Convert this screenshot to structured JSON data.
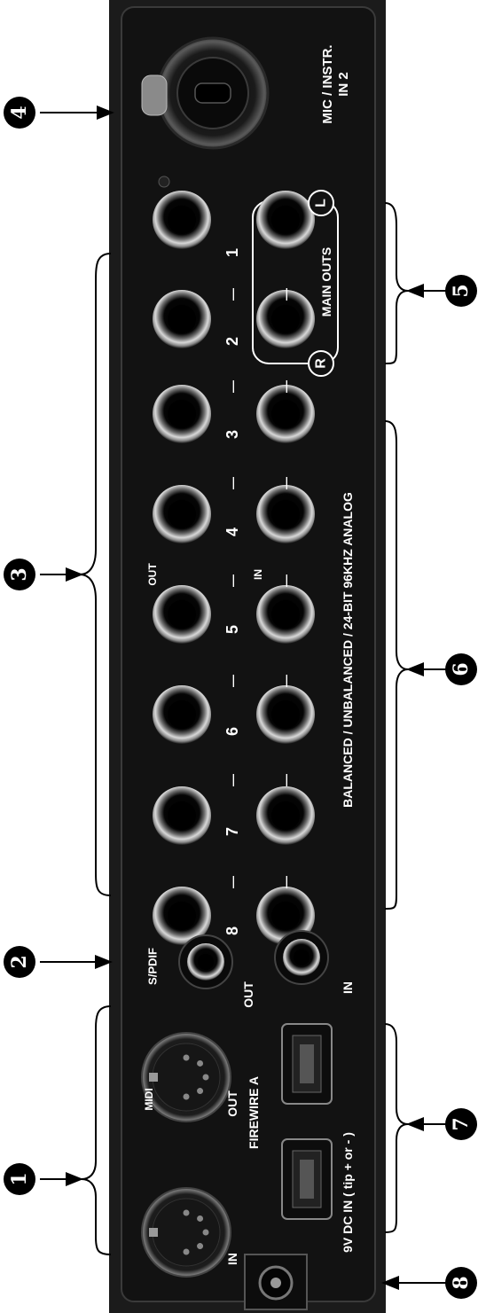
{
  "callouts": [
    "1",
    "2",
    "3",
    "4",
    "5",
    "6",
    "7",
    "8"
  ],
  "panel": {
    "mic_instr_line1": "MIC / INSTR.",
    "mic_instr_line2": "IN 2",
    "main_outs": "MAIN OUTS",
    "main_outs_l": "L",
    "main_outs_r": "R",
    "analog_label": "BALANCED / UNBALANCED / 24-BIT 96KHZ ANALOG",
    "out_label": "OUT",
    "in_label": "IN",
    "channel_numbers": [
      "1",
      "2",
      "3",
      "4",
      "5",
      "6",
      "7",
      "8"
    ],
    "dash": "—",
    "spdif": "S/PDIF",
    "spdif_out": "OUT",
    "spdif_in": "IN",
    "midi": "MIDI",
    "midi_out": "OUT",
    "midi_in": "IN",
    "firewire": "FIREWIRE A",
    "dc_in": "9V DC IN ( tip + or - )"
  }
}
